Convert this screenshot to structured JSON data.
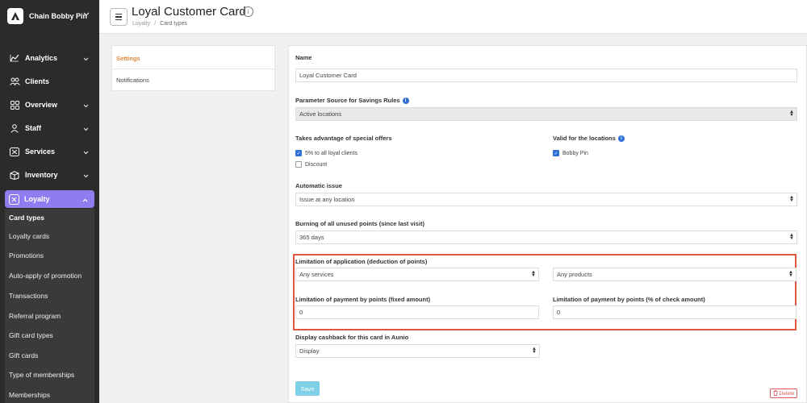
{
  "sidebar": {
    "brand": "Chain Bobby Pin",
    "items": [
      {
        "label": "Analytics",
        "icon": "chart-line-icon",
        "has_chevron": true
      },
      {
        "label": "Clients",
        "icon": "users-icon",
        "has_chevron": false
      },
      {
        "label": "Overview",
        "icon": "grid-icon",
        "has_chevron": true
      },
      {
        "label": "Staff",
        "icon": "user-icon",
        "has_chevron": true
      },
      {
        "label": "Services",
        "icon": "scissors-icon",
        "has_chevron": true
      },
      {
        "label": "Inventory",
        "icon": "box-icon",
        "has_chevron": true
      }
    ],
    "active_item": {
      "label": "Loyalty",
      "icon": "loyalty-icon"
    },
    "submenu": [
      "Card types",
      "Loyalty cards",
      "Promotions",
      "Auto-apply of promotion",
      "Transactions",
      "Referral program",
      "Gift card types",
      "Gift cards",
      "Type of memberships",
      "Memberships"
    ],
    "accent_color": "#8f7cf0"
  },
  "header": {
    "title": "Loyal Customer Card",
    "breadcrumb": [
      "Loyalty",
      "Card types"
    ]
  },
  "tabs": {
    "settings": "Settings",
    "notifications": "Notifications"
  },
  "form": {
    "name_label": "Name",
    "name_value": "Loyal Customer Card",
    "param_source_label": "Parameter Source for Savings Rules",
    "param_source_value": "Active locations",
    "special_offers_label": "Takes advantage of special offers",
    "offer_1": "5% to all loyal clients",
    "offer_1_checked": true,
    "offer_2": "Discount",
    "offer_2_checked": false,
    "valid_locations_label": "Valid for the locations",
    "location_1": "Bobby Pin",
    "location_1_checked": true,
    "auto_issue_label": "Automatic issue",
    "auto_issue_value": "Issue at any location",
    "burning_label": "Burning of all unused points (since last visit)",
    "burning_value": "365 days",
    "limitation_label": "Limitation of application (deduction of points)",
    "limitation_services_value": "Any services",
    "limitation_products_value": "Any products",
    "limit_fixed_label": "Limitation of payment by points (fixed amount)",
    "limit_fixed_value": "0",
    "limit_percent_label": "Limitation of payment by points (% of check amount)",
    "limit_percent_value": "0",
    "cashback_label": "Display cashback for this card in Aunio",
    "cashback_value": "Display",
    "save_label": "Save",
    "delete_label": "Delete"
  },
  "colors": {
    "sidebar_bg": "#2b2b2b",
    "active_tab": "#e08a3c",
    "highlight_border": "#e0563e",
    "save_button": "#7fd0e6",
    "delete_button": "#e05a5a"
  }
}
